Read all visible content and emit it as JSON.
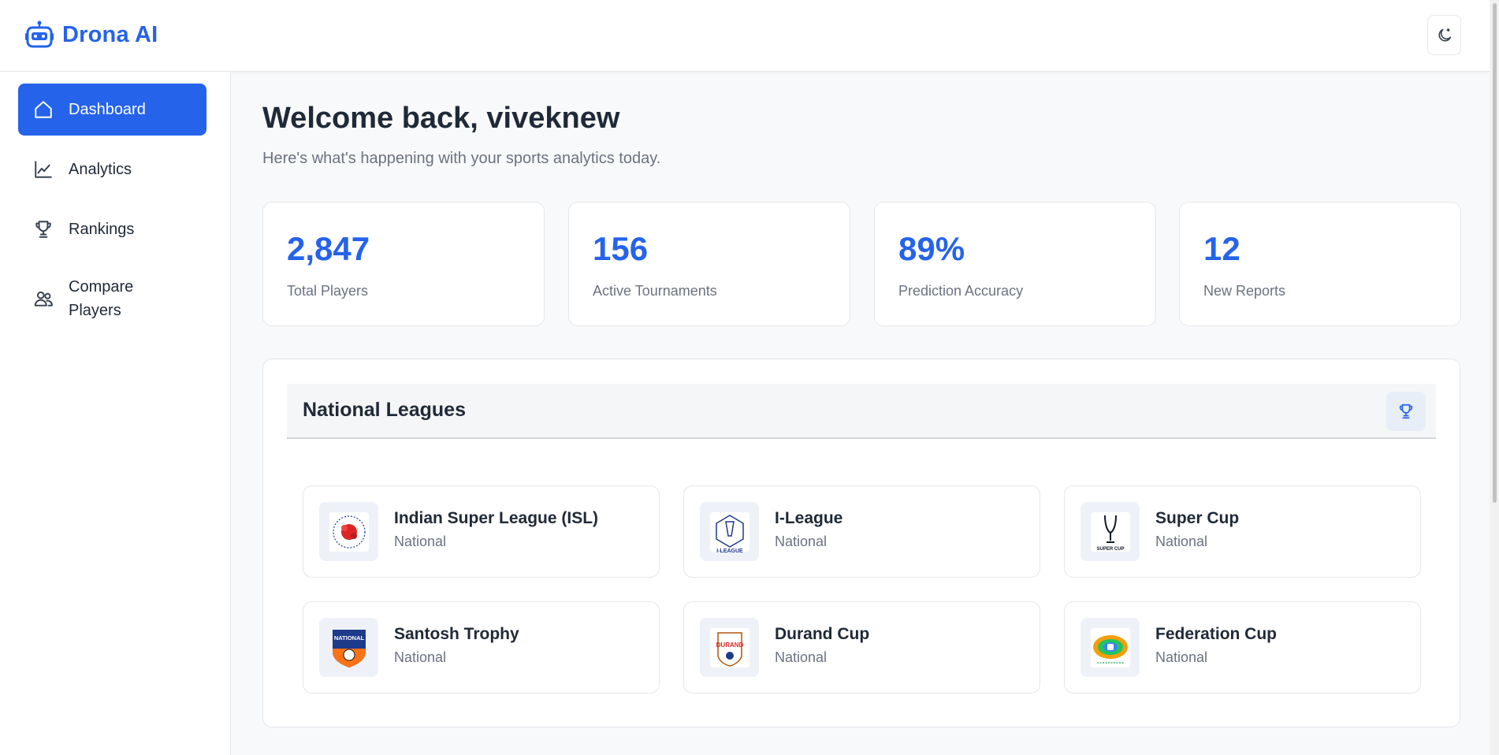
{
  "app": {
    "name": "Drona AI",
    "accent": "#2563eb"
  },
  "sidebar": {
    "items": [
      {
        "label": "Dashboard",
        "icon": "home-icon",
        "active": true
      },
      {
        "label": "Analytics",
        "icon": "line-chart-icon",
        "active": false
      },
      {
        "label": "Rankings",
        "icon": "trophy-icon",
        "active": false
      },
      {
        "label": "Compare Players",
        "icon": "users-icon",
        "active": false
      }
    ]
  },
  "header": {
    "theme_toggle_icon": "moon-icon"
  },
  "main": {
    "welcome": "Welcome back, viveknew",
    "subtitle": "Here's what's happening with your sports analytics today.",
    "stats": [
      {
        "value": "2,847",
        "label": "Total Players"
      },
      {
        "value": "156",
        "label": "Active Tournaments"
      },
      {
        "value": "89%",
        "label": "Prediction Accuracy"
      },
      {
        "value": "12",
        "label": "New Reports"
      }
    ],
    "leagues_section": {
      "title": "National Leagues",
      "icon": "trophy-icon",
      "items": [
        {
          "name": "Indian Super League (ISL)",
          "type": "National",
          "logo": "isl-logo"
        },
        {
          "name": "I-League",
          "type": "National",
          "logo": "i-league-logo",
          "logo_text": "I-LEAGUE"
        },
        {
          "name": "Super Cup",
          "type": "National",
          "logo": "super-cup-logo",
          "logo_text": "SUPER CUP"
        },
        {
          "name": "Santosh Trophy",
          "type": "National",
          "logo": "santosh-trophy-logo",
          "logo_text": "NATIONAL"
        },
        {
          "name": "Durand Cup",
          "type": "National",
          "logo": "durand-cup-logo",
          "logo_text": "DURAND"
        },
        {
          "name": "Federation Cup",
          "type": "National",
          "logo": "federation-cup-logo"
        }
      ]
    }
  }
}
